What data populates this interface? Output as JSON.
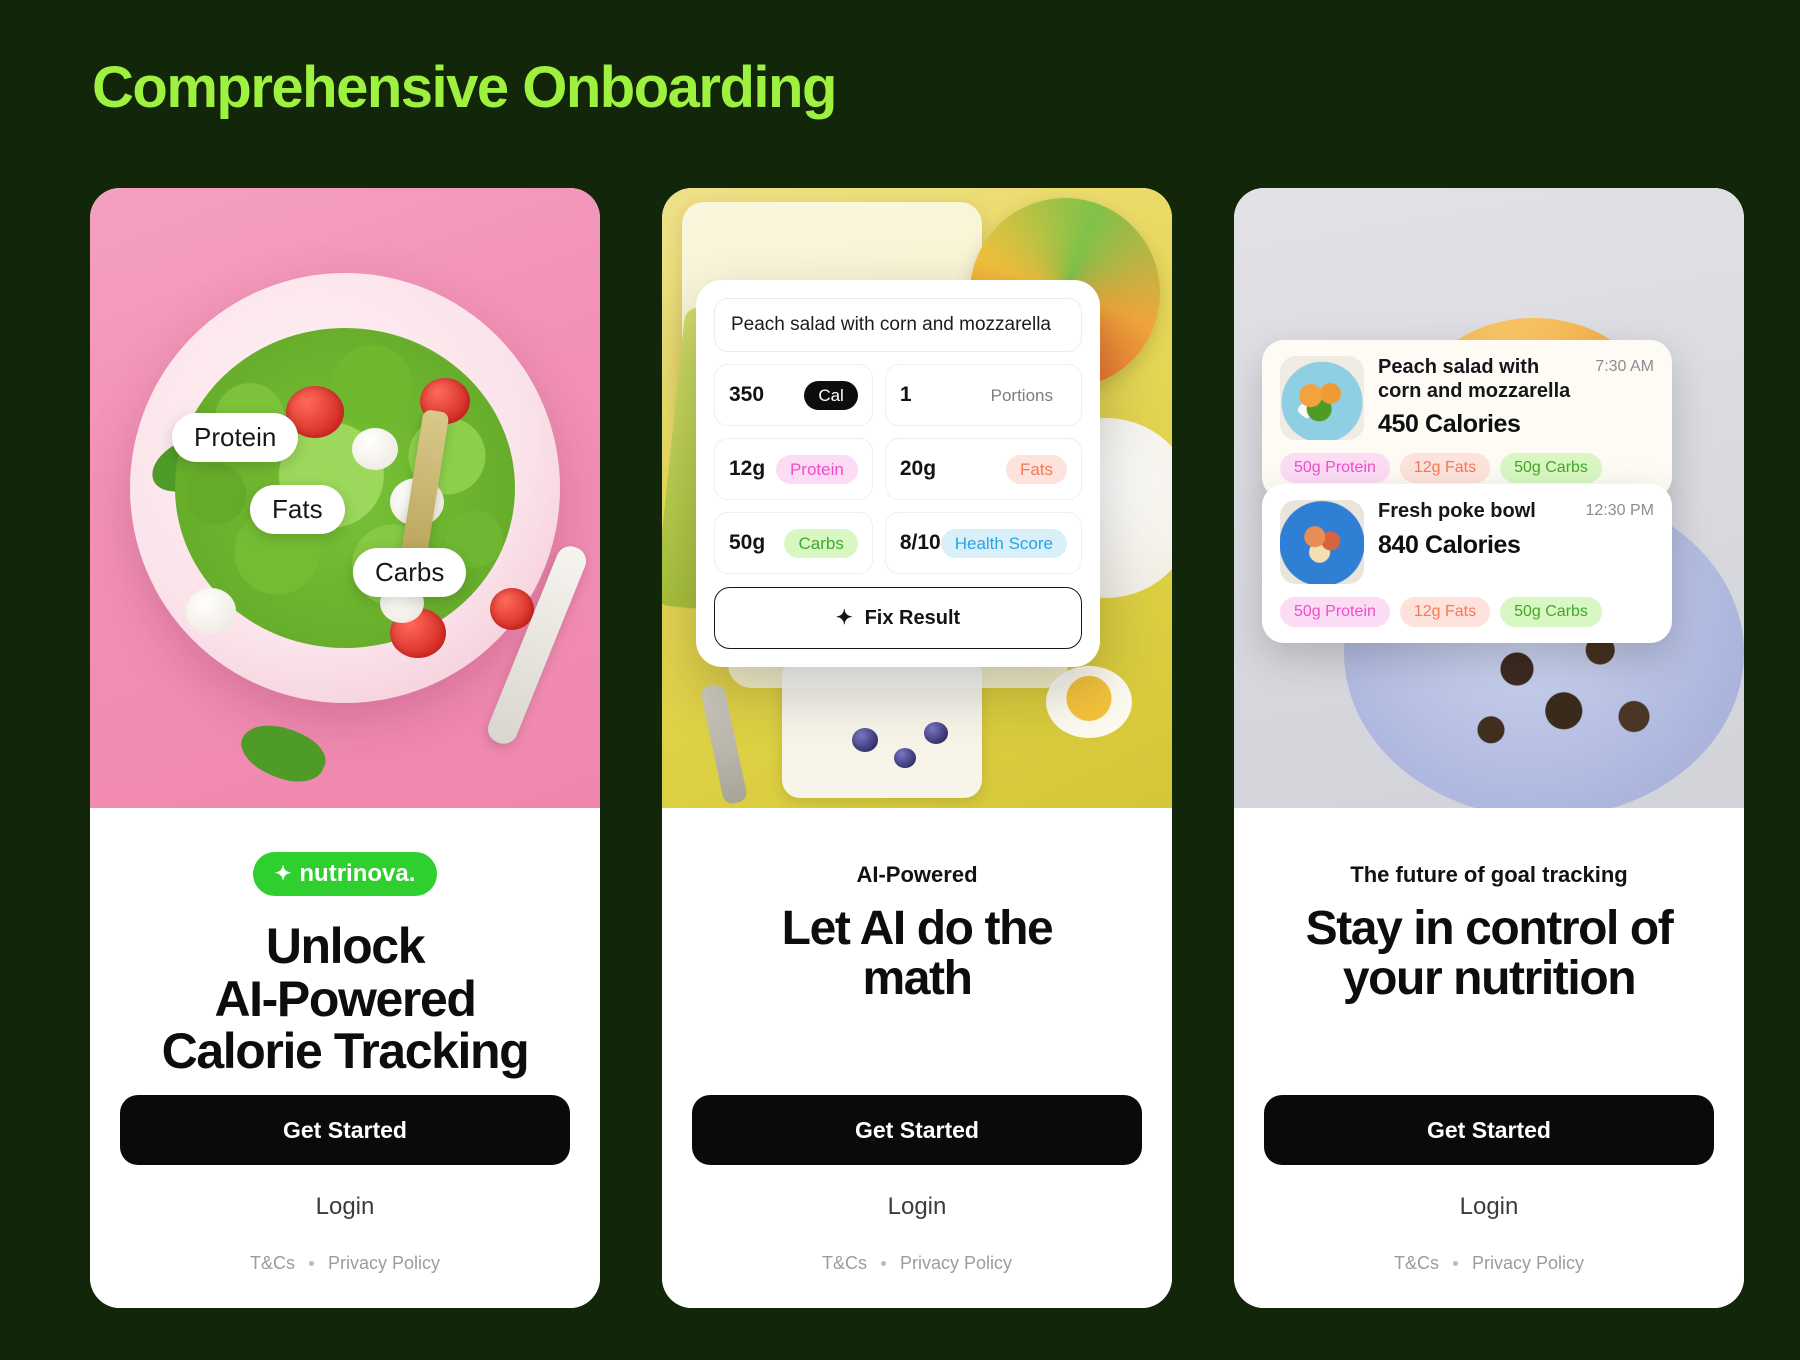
{
  "page": {
    "title": "Comprehensive Onboarding",
    "accent": "#9ef23f",
    "background": "#12260a"
  },
  "phones": [
    {
      "hero_tags": [
        "Protein",
        "Fats",
        "Carbs"
      ],
      "brand": {
        "label": "nutrinova.",
        "icon": "sparkle-icon",
        "color": "#2fcf2f"
      },
      "eyebrow": "",
      "headline": "Unlock\nAI-Powered\nCalorie Tracking",
      "headline_lines": [
        "Unlock",
        "AI-Powered",
        "Calorie Tracking"
      ],
      "cta": "Get Started",
      "login": "Login",
      "legal": [
        "T&Cs",
        "Privacy Policy"
      ]
    },
    {
      "ai_card": {
        "meal_name": "Peach salad with corn and mozzarella",
        "cells": [
          {
            "value": "350",
            "chip": "Cal",
            "chip_style": "cal"
          },
          {
            "value": "1",
            "chip": "Portions",
            "chip_style": "plain"
          },
          {
            "value": "12g",
            "chip": "Protein",
            "chip_style": "protein"
          },
          {
            "value": "20g",
            "chip": "Fats",
            "chip_style": "fats"
          },
          {
            "value": "50g",
            "chip": "Carbs",
            "chip_style": "carbs"
          },
          {
            "value": "8/10",
            "chip": "Health Score",
            "chip_style": "health"
          }
        ],
        "fix_button": "Fix Result",
        "fix_icon": "sparkle-icon"
      },
      "eyebrow": "AI-Powered",
      "headline_lines": [
        "Let AI do the",
        "math"
      ],
      "cta": "Get Started",
      "login": "Login",
      "legal": [
        "T&Cs",
        "Privacy Policy"
      ]
    },
    {
      "meals": [
        {
          "thumb": "salad-thumb",
          "title": "Peach salad with corn and mozzarella",
          "time": "7:30 AM",
          "calories": "450 Calories",
          "badges": [
            "50g Protein",
            "12g Fats",
            "50g Carbs"
          ]
        },
        {
          "thumb": "poke-bowl-thumb",
          "title": "Fresh poke bowl",
          "time": "12:30 PM",
          "calories": "840 Calories",
          "badges": [
            "50g Protein",
            "12g Fats",
            "50g Carbs"
          ]
        }
      ],
      "eyebrow": "The future of goal tracking",
      "headline_lines": [
        "Stay in control of",
        "your nutrition"
      ],
      "cta": "Get Started",
      "login": "Login",
      "legal": [
        "T&Cs",
        "Privacy Policy"
      ]
    }
  ]
}
